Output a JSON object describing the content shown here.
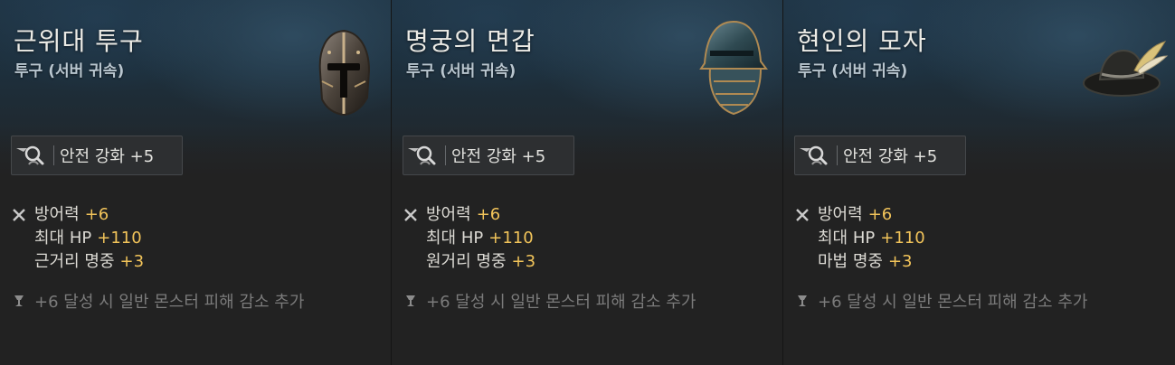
{
  "cards": [
    {
      "title": "근위대 투구",
      "subtitle": "투구 (서버 귀속)",
      "enhance": "안전 강화 +5",
      "stats": [
        {
          "label": "방어력",
          "value": "+6"
        },
        {
          "label": "최대 HP",
          "value": "+110"
        },
        {
          "label": "근거리 명중",
          "value": "+3"
        }
      ],
      "bonus": "+6 달성 시 일반 몬스터 피해 감소 추가",
      "icon": "knight-helmet-icon"
    },
    {
      "title": "명궁의 면갑",
      "subtitle": "투구 (서버 귀속)",
      "enhance": "안전 강화 +5",
      "stats": [
        {
          "label": "방어력",
          "value": "+6"
        },
        {
          "label": "최대 HP",
          "value": "+110"
        },
        {
          "label": "원거리 명중",
          "value": "+3"
        }
      ],
      "bonus": "+6 달성 시 일반 몬스터 피해 감소 추가",
      "icon": "sallet-helmet-icon"
    },
    {
      "title": "현인의 모자",
      "subtitle": "투구 (서버 귀속)",
      "enhance": "안전 강화 +5",
      "stats": [
        {
          "label": "방어력",
          "value": "+6"
        },
        {
          "label": "최대 HP",
          "value": "+110"
        },
        {
          "label": "마법 명중",
          "value": "+3"
        }
      ],
      "bonus": "+6 달성 시 일반 몬스터 피해 감소 추가",
      "icon": "feathered-hat-icon"
    }
  ],
  "colors": {
    "stat_value": "#f2c45a",
    "title": "#ecebe6",
    "subtitle": "#b9c6cf",
    "bonus": "#7b7b7b"
  }
}
